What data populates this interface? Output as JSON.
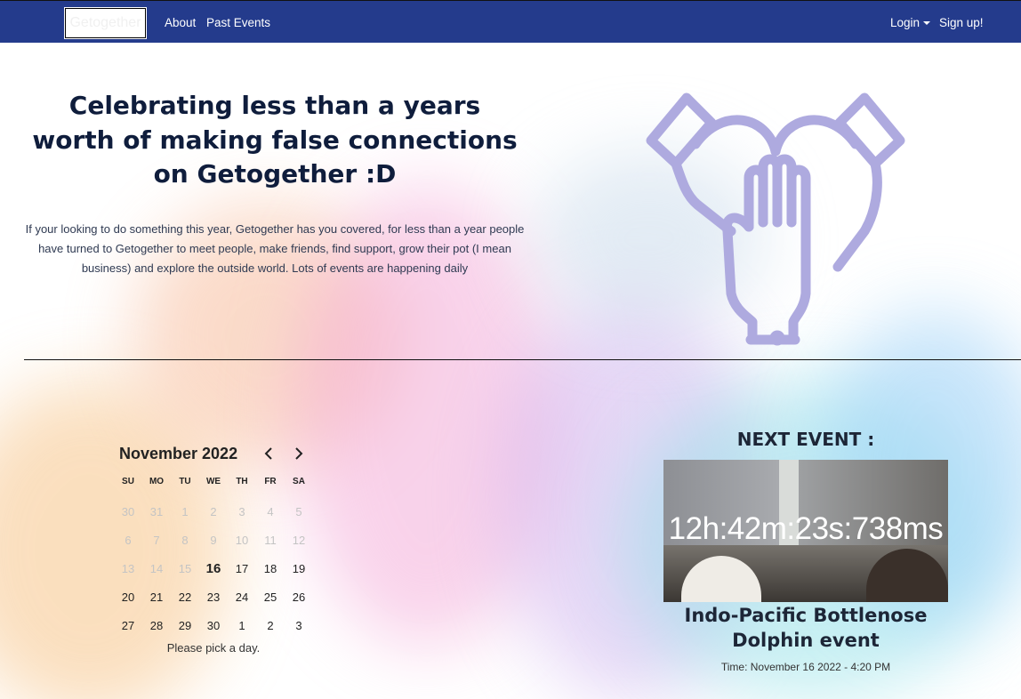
{
  "navbar": {
    "brand": "Getogether",
    "links": [
      {
        "label": "About"
      },
      {
        "label": "Past Events"
      }
    ],
    "login_label": "Login",
    "signup_label": "Sign up!"
  },
  "hero": {
    "title": "Celebrating less than a years worth of making false connections on Getogether :D",
    "text": "If your looking to do something this year, Getogether has you covered, for less than a year people have turned to Getogether to meet people, make friends, find support, grow their pot (I mean business) and explore the outside world. Lots of events are happening daily",
    "icon": "hands-together-icon",
    "icon_color": "#aeaadf"
  },
  "calendar": {
    "month_label": "November 2022",
    "weekdays": [
      "SU",
      "MO",
      "TU",
      "WE",
      "TH",
      "FR",
      "SA"
    ],
    "days": [
      {
        "label": "30",
        "muted": true
      },
      {
        "label": "31",
        "muted": true
      },
      {
        "label": "1",
        "muted": true
      },
      {
        "label": "2",
        "muted": true
      },
      {
        "label": "3",
        "muted": true
      },
      {
        "label": "4",
        "muted": true
      },
      {
        "label": "5",
        "muted": true
      },
      {
        "label": "6",
        "muted": true
      },
      {
        "label": "7",
        "muted": true
      },
      {
        "label": "8",
        "muted": true
      },
      {
        "label": "9",
        "muted": true
      },
      {
        "label": "10",
        "muted": true
      },
      {
        "label": "11",
        "muted": true
      },
      {
        "label": "12",
        "muted": true
      },
      {
        "label": "13",
        "muted": true
      },
      {
        "label": "14",
        "muted": true
      },
      {
        "label": "15",
        "muted": true
      },
      {
        "label": "16",
        "today": true
      },
      {
        "label": "17"
      },
      {
        "label": "18"
      },
      {
        "label": "19"
      },
      {
        "label": "20"
      },
      {
        "label": "21"
      },
      {
        "label": "22"
      },
      {
        "label": "23"
      },
      {
        "label": "24"
      },
      {
        "label": "25"
      },
      {
        "label": "26"
      },
      {
        "label": "27"
      },
      {
        "label": "28"
      },
      {
        "label": "29"
      },
      {
        "label": "30"
      },
      {
        "label": "1"
      },
      {
        "label": "2"
      },
      {
        "label": "3"
      }
    ],
    "footer": "Please pick a day."
  },
  "next_event": {
    "heading": "NEXT EVENT :",
    "countdown": "12h:42m:23s:738ms",
    "name": "Indo-Pacific Bottlenose Dolphin event",
    "time": "Time: November 16 2022 - 4:20 PM"
  },
  "colors": {
    "navbar": "#243b8c",
    "heading": "#0f1d3c",
    "icon": "#aeaadf"
  }
}
